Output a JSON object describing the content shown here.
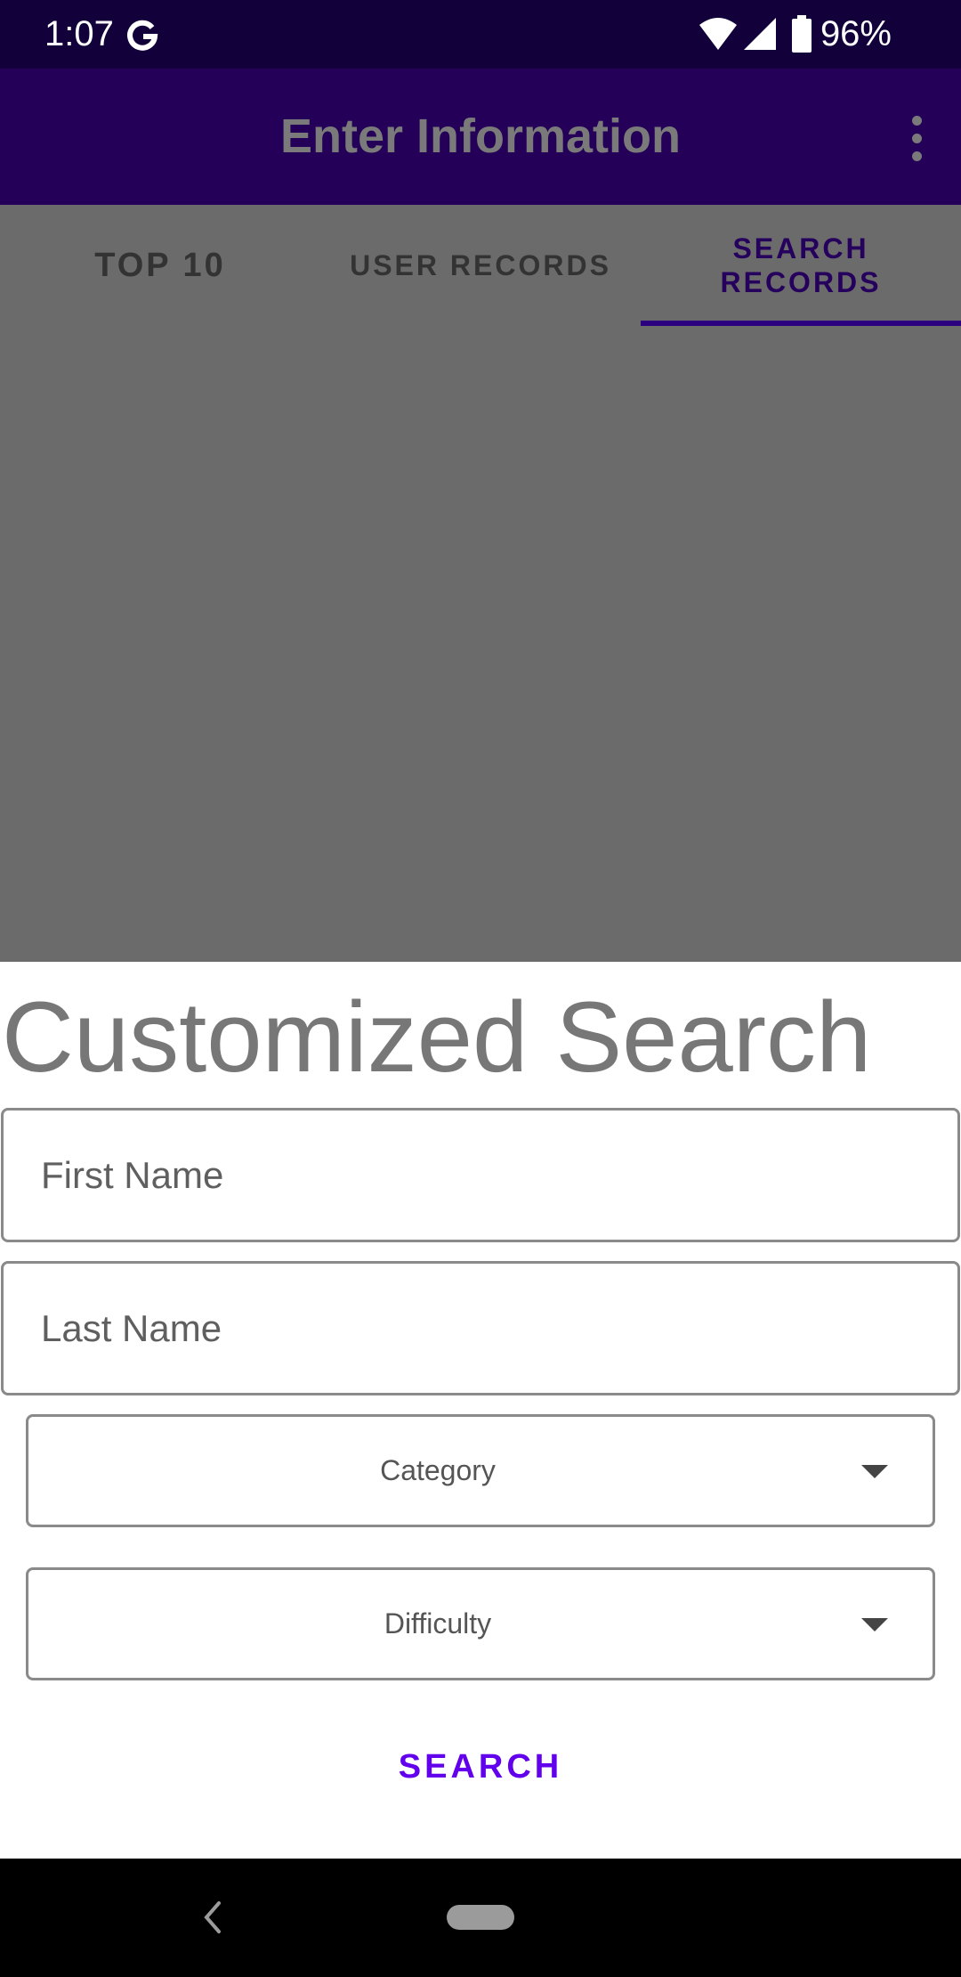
{
  "status_bar": {
    "time": "1:07",
    "battery": "96%",
    "icons": [
      "google-g-icon",
      "wifi-icon",
      "signal-icon",
      "battery-icon"
    ]
  },
  "app_bar": {
    "title": "Enter Information",
    "menu_icon": "more-vert-icon"
  },
  "tabs": [
    {
      "label": "TOP 10",
      "selected": false
    },
    {
      "label": "USER RECORDS",
      "selected": false
    },
    {
      "label": "SEARCH RECORDS",
      "selected": true
    }
  ],
  "search_sheet": {
    "title": "Customized Search",
    "first_name_placeholder": "First Name",
    "last_name_placeholder": "Last Name",
    "category": "Category",
    "difficulty": "Difficulty",
    "search_label": "SEARCH"
  },
  "nav_bar": {
    "icons": [
      "back-icon",
      "home-pill-icon"
    ]
  },
  "colors": {
    "status_bar": "#11003a",
    "app_bar": "#240058",
    "scrim": "#6b6b6b",
    "accent": "#6200ee",
    "selected_tab": "#25005c"
  }
}
